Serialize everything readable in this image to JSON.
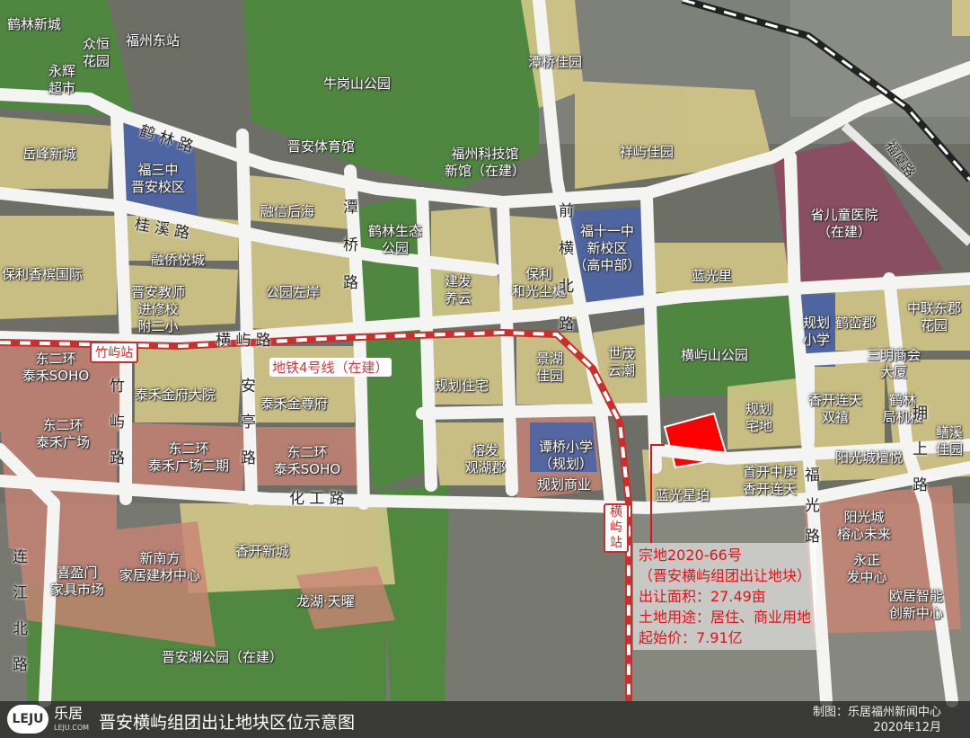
{
  "labels": {
    "helin_xincheng": "鹤林新城",
    "fuzhou_dongzhan": "福州东站",
    "zhongheng_huayuan": "众恒\n花园",
    "yonghui_chaoshi": "永辉\n超市",
    "yuefeng_xincheng": "岳峰新城",
    "niugangshan_gongyuan": "牛岗山公园",
    "tanqiao_jiayuan": "潭桥佳园",
    "jinan_tiyuguan": "晋安体育馆",
    "fuzhou_kejiguan": "福州科技馆\n新馆（在建）",
    "xiangyu_jiayuan": "祥屿佳园",
    "fusanzhong": "福三中\n晋安校区",
    "rongxin_houhai": "融信后海",
    "helin_shengtai": "鹤林生态\n公园",
    "fushiyi_zhong": "福十一中\n新校区\n（高中部）",
    "sheng_ertong": "省儿童医院\n（在建）",
    "baoli_xiangbin": "保利香槟国际",
    "rongqiao_yuecheng": "融侨悦城",
    "jianfa_yangyun": "建发\n养云",
    "baoli_heguang": "保利\n和光尘樾",
    "languangli": "蓝光里",
    "gongyuan_zuoan": "公园左岸",
    "jinan_jiaoshi": "晋安教师\n进修校\n附二小",
    "guihua_xiaoxue": "规划\n小学",
    "heluan_jun": "鹤峦郡",
    "zhonglian_dongjun": "中联东郡\n花园",
    "hengyushan_gongyuan": "横屿山公园",
    "sanming_shanghui": "三明商会\n大厦",
    "jinghu_jiayuan": "景湖\n佳园",
    "shimao_yunchao": "世茂\n云潮",
    "guihua_zhuzhai": "规划住宅",
    "dongerhuan_taihe_soho": "东二环\n泰禾SOHO",
    "taihe_jinfu": "泰禾金府大院",
    "taihe_jinzun": "泰禾金尊府",
    "guihua_zhaidi": "规划\n宅地",
    "xiangkai_shuangxi": "香开连天\n双禧",
    "helin_juji": "鹤林\n局机楼",
    "dongerhuan_guangchang": "东二环\n泰禾广场",
    "rongfa_guanhu": "榕发\n观湖郡",
    "tanqiao_xiaoxue": "谭桥小学\n（规划）",
    "shoukai_zhonggeng": "首开中庚\n香开连天",
    "yangguang_tanyue": "阳光城檀悦",
    "xieshui_jiayuan": "鳝溪\n佳园",
    "dongerhuan_erqi": "东二环\n泰禾广场二期",
    "dongerhuan_soho2": "东二环\n泰禾SOHO",
    "guihua_shangye": "规划商业",
    "languang_xingbo": "蓝光星珀",
    "xinnanfang": "新南方\n家居建材中心",
    "ximen_jiaju": "喜盈门\n家具市场",
    "xiangkai_xincheng": "香开新城",
    "yangguang_rongxin": "阳光城\n榕心未来",
    "longhu_tianyao": "龙湖·天曜",
    "yongzheng_fazhan": "永正\n发中心",
    "ouju_zhineng": "欧居智能\n创新中心",
    "jinanhu_gongyuan": "晋安湖公园（在建）"
  },
  "roads": {
    "helin_lu": "鹤 林 路",
    "guixi_lu": "桂 溪 路",
    "tanqiao_lu": "潭\n桥\n路",
    "qianheng_lu": "前\n横\n北\n路",
    "hengyu_lu": "横 屿 路",
    "zhuyu_lu": "竹\n屿\n路",
    "anting_lu": "安\n亭\n路",
    "huagong_lu": "化 工 路",
    "lianjiang_beilu": "连\n江\n北\n路",
    "fuguang_lu": "福\n光\n路",
    "yongshang_lu": "拥\n上\n路",
    "fuxia_lu": "福厦路"
  },
  "metro": {
    "line_label": "地铁4号线（在建）",
    "station_zhuyu": "竹屿站",
    "station_hengyu": "横\n屿\n站"
  },
  "info": {
    "plot_no": "宗地2020-66号",
    "plot_desc": "（晋安横屿组团出让地块）",
    "area": "出让面积：27.49亩",
    "usage": "土地用途：居住、商业用地",
    "price": "起始价：7.91亿"
  },
  "footer": {
    "logo": "LEJU",
    "brand": "乐居",
    "brand_sub": "LEJU.COM",
    "title": "晋安横屿组团出让地块区位示意图",
    "credit": "制图：乐居福州新闻中心",
    "date": "2020年12月"
  },
  "colors": {
    "residential": "#d8cc8a",
    "school": "#4a64a8",
    "hospital": "#8c4a62",
    "park": "#4c8a3c",
    "commercial": "#c98474",
    "target": "#ff0000",
    "metro": "#d9363e"
  }
}
